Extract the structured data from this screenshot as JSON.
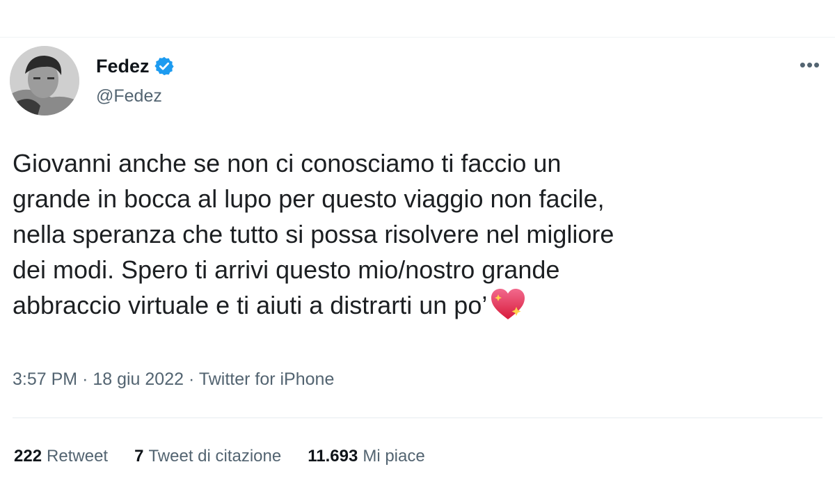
{
  "author": {
    "display_name": "Fedez",
    "handle": "@Fedez",
    "verified_icon": "verified-badge-icon",
    "verified_color": "#1d9bf0"
  },
  "menu_icon": "more-icon",
  "menu_glyph": "•••",
  "tweet": {
    "text": "Giovanni anche se non ci conosciamo ti faccio un\ngrande in bocca al lupo per questo viaggio non facile,\nnella speranza che tutto si possa risolvere nel migliore\ndei modi. Spero ti arrivi questo mio/nostro grande\nabbraccio virtuale e ti aiuti a distrarti un po’",
    "emoji": "sparkling-heart-icon"
  },
  "meta": {
    "time": "3:57 PM",
    "separator": "·",
    "date": "18 giu 2022",
    "source": "Twitter for iPhone"
  },
  "stats": {
    "retweets": {
      "count": "222",
      "label": "Retweet"
    },
    "quotes": {
      "count": "7",
      "label": "Tweet di citazione"
    },
    "likes": {
      "count": "11.693",
      "label": "Mi piace"
    }
  }
}
